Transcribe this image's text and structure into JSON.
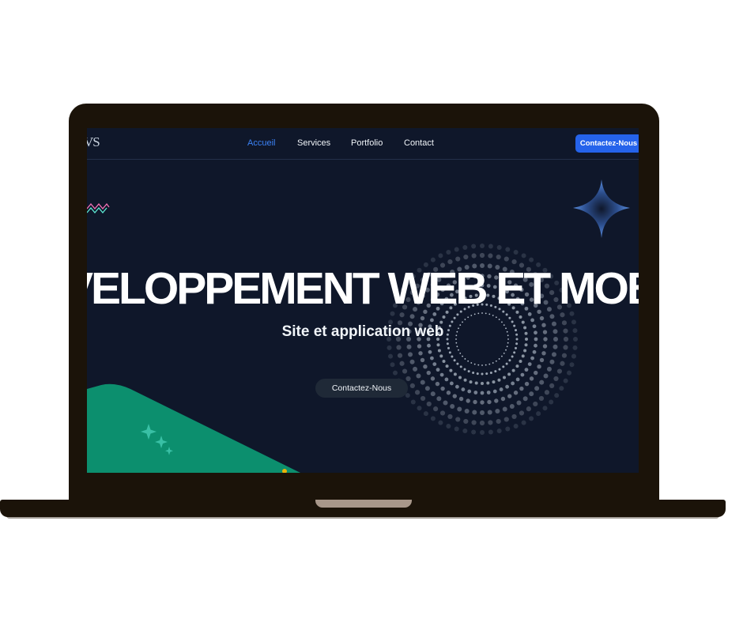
{
  "site": {
    "logo_text": "VS",
    "nav": [
      {
        "label": "Accueil",
        "active": true
      },
      {
        "label": "Services",
        "active": false
      },
      {
        "label": "Portfolio",
        "active": false
      },
      {
        "label": "Contact",
        "active": false
      }
    ],
    "nav_cta_label": "Contactez-Nous",
    "hero": {
      "title": "VELOPPEMENT WEB ET MOBILE",
      "subtitle": "Site et application web",
      "cta_label": "Contactez-Nous"
    }
  },
  "colors": {
    "screen_bg": "#0f172a",
    "accent_blue": "#2563eb",
    "active_link": "#3b82f6",
    "green_shape": "#0c8f6e",
    "laptop_frame": "#1b1309"
  },
  "icons": [
    "zigzag-icon",
    "four-point-star-icon",
    "sparkle-icon",
    "dotted-circle-graphic"
  ]
}
